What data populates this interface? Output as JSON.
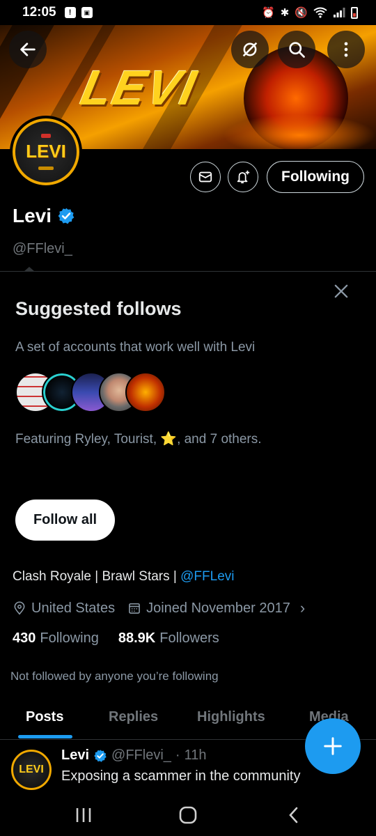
{
  "status_bar": {
    "time": "12:05",
    "left_icons": [
      "alert-icon",
      "photo-icon"
    ],
    "right_icons": [
      "alarm-icon",
      "bluetooth-icon",
      "mute-icon",
      "wifi-icon",
      "signal-icon",
      "battery-icon"
    ]
  },
  "banner": {
    "title": "LEVI"
  },
  "profile": {
    "avatar_text": "LEVI",
    "display_name": "Levi",
    "handle": "@FFlevi_",
    "following_button": "Following"
  },
  "suggested": {
    "title": "Suggested follows",
    "description": "A set of accounts that work well with Levi",
    "featuring_prefix": "Featuring Ryley, Tourist, ",
    "featuring_star": "⭐",
    "featuring_suffix": ", and 7 others.",
    "follow_all_label": "Follow all"
  },
  "bio": {
    "text": "Clash Royale | Brawl Stars | ",
    "mention": "@FFLevi",
    "location": "United States",
    "joined": "Joined November 2017",
    "following_count": "430",
    "following_label": "Following",
    "followers_count": "88.9K",
    "followers_label": "Followers",
    "not_followed": "Not followed by anyone you’re following"
  },
  "tabs": [
    {
      "label": "Posts",
      "active": true
    },
    {
      "label": "Replies",
      "active": false
    },
    {
      "label": "Highlights",
      "active": false
    },
    {
      "label": "Media",
      "active": false
    }
  ],
  "tweet": {
    "avatar_text": "LEVI",
    "name": "Levi",
    "handle": "@FFlevi_",
    "separator": "·",
    "time": "11h",
    "text": "Exposing a scammer in the community"
  },
  "colors": {
    "accent": "#1d9bf0",
    "background": "#000000",
    "secondary_text": "#71767b"
  }
}
